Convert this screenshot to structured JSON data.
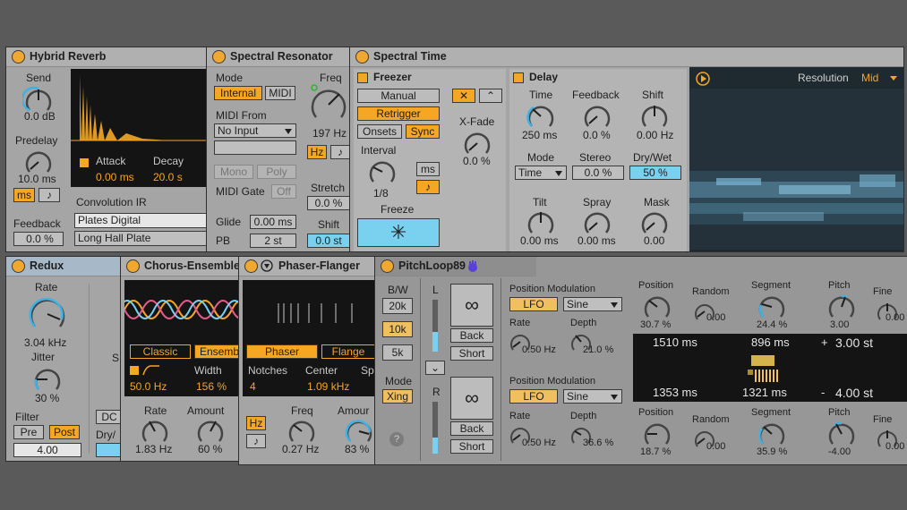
{
  "colors": {
    "accent": "#f5a623",
    "blue": "#7ad0ef",
    "panel": "#a5a5a5",
    "display": "#141414"
  },
  "hybrid": {
    "title": "Hybrid Reverb",
    "send": "Send",
    "send_val": "0.0 dB",
    "predelay": "Predelay",
    "predelay_val": "10.0 ms",
    "ms": "ms",
    "note": "♪",
    "feedback": "Feedback",
    "feedback_val": "0.0 %",
    "attack": "Attack",
    "attack_val": "0.00 ms",
    "decay": "Decay",
    "decay_val": "20.0 s",
    "conv_ir": "Convolution IR",
    "ir_category": "Plates Digital",
    "ir_name": "Long Hall Plate"
  },
  "spectral_res": {
    "title": "Spectral Resonator",
    "mode": "Mode",
    "internal": "Internal",
    "midi": "MIDI",
    "midi_from": "MIDI From",
    "no_input": "No Input",
    "mono": "Mono",
    "poly": "Poly",
    "midi_gate": "MIDI Gate",
    "off": "Off",
    "glide": "Glide",
    "glide_val": "0.00 ms",
    "pb": "PB",
    "pb_val": "2 st",
    "freq": "Freq",
    "freq_val": "197 Hz",
    "hz": "Hz",
    "note": "♪",
    "stretch": "Stretch",
    "stretch_val": "0.0 %",
    "shift": "Shift",
    "shift_val": "0.0 st"
  },
  "spectral_time": {
    "title": "Spectral Time",
    "freezer": "Freezer",
    "manual": "Manual",
    "retrigger": "Retrigger",
    "onsets": "Onsets",
    "sync": "Sync",
    "interval": "Interval",
    "interval_val": "1/8",
    "ms": "ms",
    "note": "♪",
    "freeze": "Freeze",
    "freeze_icon": "✳",
    "xfade": "X-Fade",
    "xfade_val": "0.0 %",
    "delay": "Delay",
    "time": "Time",
    "time_val": "250 ms",
    "feedback": "Feedback",
    "feedback_val": "0.0 %",
    "shift": "Shift",
    "shift_val": "0.00 Hz",
    "mode": "Mode",
    "mode_val": "Time",
    "stereo": "Stereo",
    "stereo_val": "0.0 %",
    "drywet": "Dry/Wet",
    "drywet_val": "50 %",
    "tilt": "Tilt",
    "tilt_val": "0.00 ms",
    "spray": "Spray",
    "spray_val": "0.00 ms",
    "mask": "Mask",
    "mask_val": "0.00",
    "resolution": "Resolution",
    "resolution_val": "Mid"
  },
  "redux": {
    "title": "Redux",
    "rate": "Rate",
    "rate_val": "3.04 kHz",
    "jitter": "Jitter",
    "jitter_val": "30 %",
    "filter": "Filter",
    "pre": "Pre",
    "post": "Post",
    "filter_val": "4.00",
    "s_label": "S",
    "dc": "DC",
    "drywet": "Dry/"
  },
  "chorus": {
    "title": "Chorus-Ensemble",
    "classic": "Classic",
    "ensemble": "Ensemb",
    "hz_val": "50.0 Hz",
    "width": "Width",
    "width_val": "156 %",
    "rate": "Rate",
    "rate_val": "1.83 Hz",
    "amount": "Amount",
    "amount_val": "60 %"
  },
  "phaser": {
    "title": "Phaser-Flanger",
    "phaser": "Phaser",
    "flanger": "Flange",
    "notches": "Notches",
    "notches_val": "4",
    "center": "Center",
    "center_val": "1.09 kHz",
    "sp": "Sp",
    "hz": "Hz",
    "note": "♪",
    "freq": "Freq",
    "freq_val": "0.27 Hz",
    "amount": "Amour",
    "amount_val": "83 %"
  },
  "pitchloop": {
    "title": "PitchLoop89",
    "bw": "B/W",
    "bw_20k": "20k",
    "bw_10k": "10k",
    "bw_5k": "5k",
    "mode": "Mode",
    "xing": "Xing",
    "help": "?",
    "l": "L",
    "r": "R",
    "loop_icon": "∞",
    "back": "Back",
    "short": "Short",
    "pos_mod": "Position Modulation",
    "lfo": "LFO",
    "sine": "Sine",
    "rate": "Rate",
    "depth": "Depth",
    "rate1": "0.50 Hz",
    "depth1": "21.0 %",
    "rate2": "0.50 Hz",
    "depth2": "36.6 %",
    "position": "Position",
    "random": "Random",
    "segment": "Segment",
    "pitch": "Pitch",
    "fine": "Fine",
    "pos1": "30.7 %",
    "rnd1": "0.00",
    "seg1": "24.4 %",
    "pitch1": "3.00",
    "fine1": "0.00",
    "pos2": "18.7 %",
    "rnd2": "0.00",
    "seg2": "35.9 %",
    "pitch2": "-4.00",
    "fine2": "0.00",
    "disp_a1": "1510 ms",
    "disp_b1": "896 ms",
    "disp_c1": "+",
    "disp_d1": "3.00 st",
    "disp_a2": "1353 ms",
    "disp_b2": "1321 ms",
    "disp_c2": "-",
    "disp_d2": "4.00 st"
  }
}
